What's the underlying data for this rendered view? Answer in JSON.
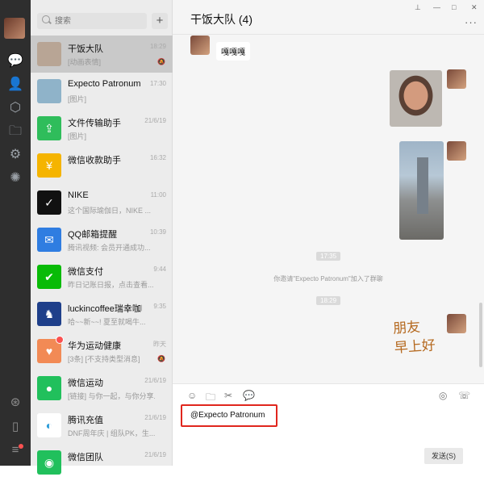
{
  "search": {
    "placeholder": "搜索"
  },
  "header": {
    "title": "干饭大队 (4)",
    "more": "···"
  },
  "window": {
    "pin": "⊥",
    "minimize": "—",
    "maximize": "□",
    "close": "✕"
  },
  "chats": [
    {
      "name": "干饭大队",
      "preview": "[动画表情]",
      "time": "18:29",
      "mute": "🔕",
      "color": "#b8a595"
    },
    {
      "name": "Expecto Patronum",
      "preview": "[图片]",
      "time": "17:30",
      "color": "#8fb3c9"
    },
    {
      "name": "文件传输助手",
      "preview": "[图片]",
      "time": "21/6/19",
      "color": "#2fbd5b"
    },
    {
      "name": "微信收款助手",
      "preview": "",
      "time": "16:32",
      "color": "#f5b400"
    },
    {
      "name": "NIKE",
      "preview": "这个国际瑜伽日，NIKE ...",
      "time": "11:00",
      "color": "#111111"
    },
    {
      "name": "QQ邮箱提醒",
      "preview": "腾讯视频: 会员开通成功...",
      "time": "10:39",
      "color": "#2f7de1"
    },
    {
      "name": "微信支付",
      "preview": "昨日记账日报，点击查看...",
      "time": "9:44",
      "color": "#09bb07"
    },
    {
      "name": "luckincoffee瑞幸咖啡",
      "preview": "哈~~新~~! 夏至就喝牛...",
      "time": "9:35",
      "color": "#1e3f8a"
    },
    {
      "name": "华为运动健康",
      "preview": "[3条] [不支持类型消息]",
      "time": "昨天",
      "mute": "🔕",
      "color": "#f28a55"
    },
    {
      "name": "微信运动",
      "preview": "[链接] 与你一起，与你分享...",
      "time": "21/6/19",
      "color": "#21c05c"
    },
    {
      "name": "腾讯充值",
      "preview": "DNF周年庆 | 组队PK，生...",
      "time": "21/6/19",
      "color": "#ffffff"
    },
    {
      "name": "微信团队",
      "preview": "",
      "time": "21/6/19",
      "color": "#21c05c"
    }
  ],
  "messages": {
    "incoming_text": "嘎嘎嘎",
    "time1": "17:35",
    "system": "你邀请\"Expecto Patronum\"加入了群聊",
    "time2": "18:29",
    "sticker_line1": "朋友",
    "sticker_line2": "早上好"
  },
  "composer": {
    "text": "@Expecto Patronum"
  },
  "toolbar": {
    "send_label": "发送(S)"
  },
  "icons": {
    "chat": "💬",
    "contacts": "👤",
    "collections": "⬡",
    "files": "🗀",
    "moments": "⚙",
    "channels": "✺",
    "miniprograms": "⊛",
    "phone": "▯",
    "menu": "≡",
    "emoji": "☺",
    "folder": "🗀",
    "scissors": "✂",
    "bubble": "💬",
    "live": "◎",
    "call": "☏"
  }
}
